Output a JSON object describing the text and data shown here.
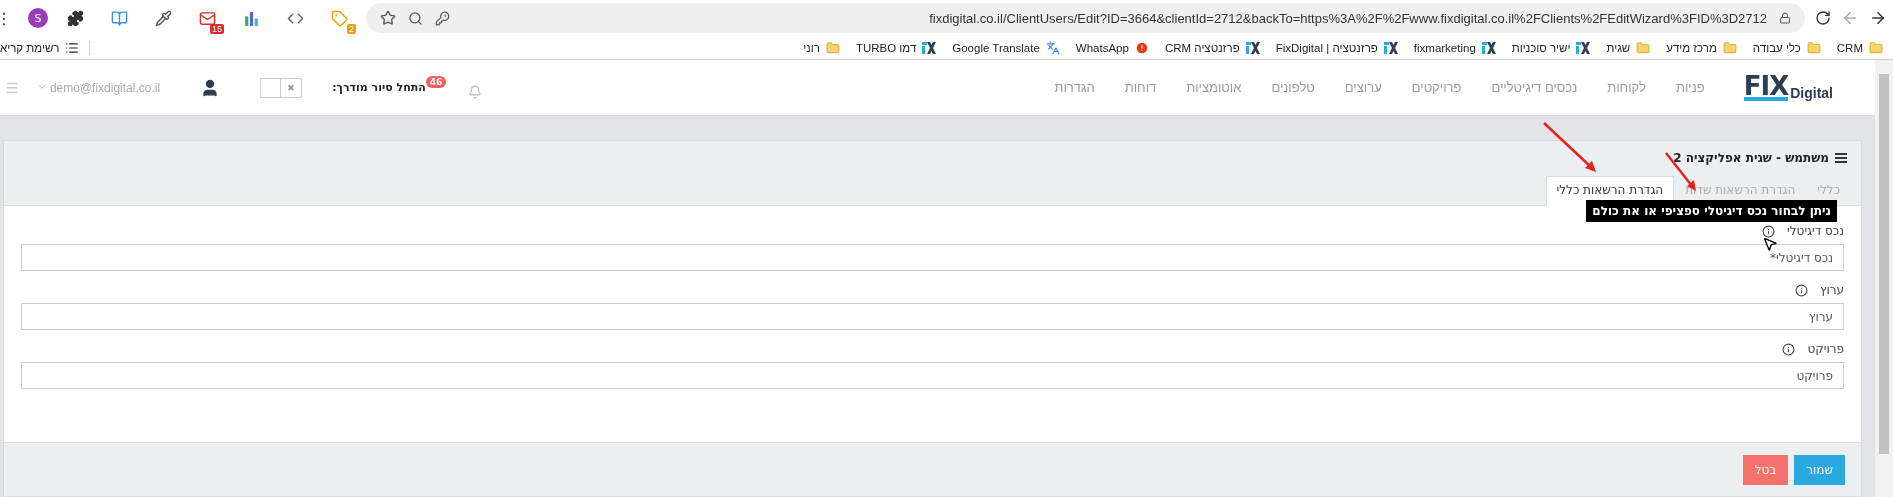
{
  "browser": {
    "menu": "⋮",
    "avatar": "S",
    "extensions": [
      {
        "kind": "tag",
        "badge": "2"
      },
      {
        "kind": "code"
      },
      {
        "kind": "chart"
      },
      {
        "kind": "mail",
        "badge": "15"
      },
      {
        "kind": "dropper"
      },
      {
        "kind": "book"
      },
      {
        "kind": "puzzle"
      }
    ],
    "url": "fixdigital.co.il/ClientUsers/Edit?ID=3664&clientId=2712&backTo=https%3A%2F%2Fwww.fixdigital.co.il%2FClients%2FEditWizard%3FID%3D2712"
  },
  "bookmarks": [
    {
      "kind": "folder",
      "label": "CRM"
    },
    {
      "kind": "folder",
      "label": "כלי עבודה"
    },
    {
      "kind": "folder",
      "label": "מרכז מידע"
    },
    {
      "kind": "folder",
      "label": "שגית"
    },
    {
      "kind": "fix",
      "label": "ישיר סוכניות"
    },
    {
      "kind": "fix",
      "label": "fixmarketing"
    },
    {
      "kind": "fix",
      "label": "פרזנטציה | FixDigital"
    },
    {
      "kind": "fix",
      "label": "פרזנטציה CRM"
    },
    {
      "kind": "alert",
      "label": "WhatsApp"
    },
    {
      "kind": "translate",
      "label": "Google Translate"
    },
    {
      "kind": "fix",
      "label": "דמו TURBO"
    },
    {
      "kind": "folder",
      "label": "רוני"
    }
  ],
  "reading_list": "רשימת קריא",
  "navbar": {
    "logo": {
      "mark": "FIX",
      "word": "Digital"
    },
    "menu": [
      "פניות",
      "לקוחות",
      "נכסים דיגיטליים",
      "פרויקטים",
      "ערוצים",
      "טלפונים",
      "אוטומציות",
      "דוחות",
      "הגדרות"
    ],
    "notifications": "46",
    "tour_label": "התחל סיור מודרך:",
    "tour_toggle": {
      "on": false,
      "off_mark": "✖"
    },
    "user_email": "demo@fixdigital.co.il",
    "menu_icon": "☰"
  },
  "panel": {
    "title": "משתמש - שגית אפליקציה 2",
    "tabs": [
      {
        "label": "כללי",
        "selected": false
      },
      {
        "label": "הגדרת הרשאות שדות",
        "selected": false
      },
      {
        "label": "הגדרת הרשאות כללי",
        "selected": true
      }
    ],
    "tooltip": "ניתן לבחור נכס דיגיטלי ספציפי או את כולם",
    "fields": [
      {
        "label": "נכס דיגיטלי",
        "placeholder": "נכס דיגיטלי*"
      },
      {
        "label": "ערוץ",
        "placeholder": "ערוץ"
      },
      {
        "label": "פרויקט",
        "placeholder": "פרויקט"
      }
    ],
    "buttons": [
      {
        "kind": "primary",
        "label": "שמור"
      },
      {
        "kind": "danger",
        "label": "בטל"
      }
    ]
  }
}
